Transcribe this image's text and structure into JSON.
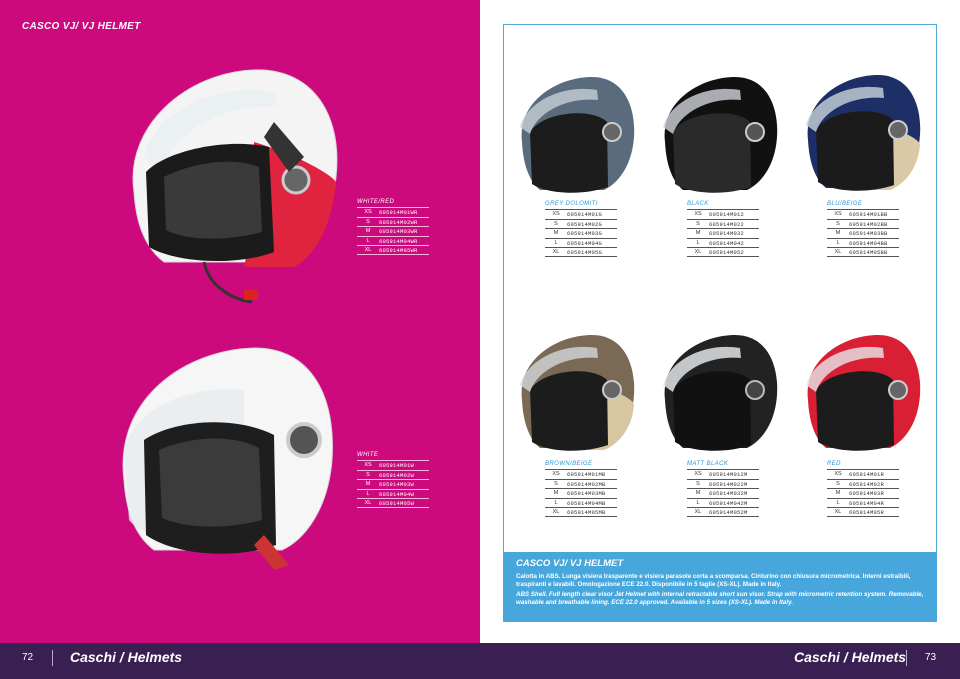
{
  "left_page": {
    "title": "CASCO VJ/ VJ HELMET",
    "page_number": "72",
    "section": "Caschi / Helmets",
    "products": [
      {
        "color_name": "WHITE/RED",
        "rows": [
          {
            "size": "XS",
            "code": "605914M01WR"
          },
          {
            "size": "S",
            "code": "605914M02WR"
          },
          {
            "size": "M",
            "code": "605914M03WR"
          },
          {
            "size": "L",
            "code": "605914M04WR"
          },
          {
            "size": "XL",
            "code": "605914M05WR"
          }
        ]
      },
      {
        "color_name": "WHITE",
        "rows": [
          {
            "size": "XS",
            "code": "605914M01W"
          },
          {
            "size": "S",
            "code": "605914M02W"
          },
          {
            "size": "M",
            "code": "605914M03W"
          },
          {
            "size": "L",
            "code": "605914M04W"
          },
          {
            "size": "XL",
            "code": "605914M05W"
          }
        ]
      }
    ]
  },
  "right_page": {
    "page_number": "73",
    "section": "Caschi / Helmets",
    "products": [
      {
        "color_name": "GREY DOLOMITI",
        "rows": [
          {
            "size": "XS",
            "code": "605914M01G"
          },
          {
            "size": "S",
            "code": "605914M02G"
          },
          {
            "size": "M",
            "code": "605914M03G"
          },
          {
            "size": "L",
            "code": "605914M04G"
          },
          {
            "size": "XL",
            "code": "605914M05G"
          }
        ]
      },
      {
        "color_name": "BLACK",
        "rows": [
          {
            "size": "XS",
            "code": "605914M012"
          },
          {
            "size": "S",
            "code": "605914M022"
          },
          {
            "size": "M",
            "code": "605914M032"
          },
          {
            "size": "L",
            "code": "605914M042"
          },
          {
            "size": "XL",
            "code": "605914M052"
          }
        ]
      },
      {
        "color_name": "BLU/BEIGE",
        "rows": [
          {
            "size": "XS",
            "code": "605914M01BB"
          },
          {
            "size": "S",
            "code": "605914M02BB"
          },
          {
            "size": "M",
            "code": "605914M03BB"
          },
          {
            "size": "L",
            "code": "605914M04BB"
          },
          {
            "size": "XL",
            "code": "605914M05BB"
          }
        ]
      },
      {
        "color_name": "BROWN/BEIGE",
        "rows": [
          {
            "size": "XS",
            "code": "605914M01MB"
          },
          {
            "size": "S",
            "code": "605914M02MB"
          },
          {
            "size": "M",
            "code": "605914M03MB"
          },
          {
            "size": "L",
            "code": "605914M04MB"
          },
          {
            "size": "XL",
            "code": "605914M05MB"
          }
        ]
      },
      {
        "color_name": "MATT BLACK",
        "rows": [
          {
            "size": "XS",
            "code": "605914M012M"
          },
          {
            "size": "S",
            "code": "605914M022M"
          },
          {
            "size": "M",
            "code": "605914M032M"
          },
          {
            "size": "L",
            "code": "605914M042M"
          },
          {
            "size": "XL",
            "code": "605914M052M"
          }
        ]
      },
      {
        "color_name": "RED",
        "rows": [
          {
            "size": "XS",
            "code": "605914M01R"
          },
          {
            "size": "S",
            "code": "605914M02R"
          },
          {
            "size": "M",
            "code": "605914M03R"
          },
          {
            "size": "L",
            "code": "605914M04R"
          },
          {
            "size": "XL",
            "code": "605914M05R"
          }
        ]
      }
    ],
    "info": {
      "title": "CASCO VJ/ VJ HELMET",
      "text_it": "Calotta in ABS. Lunga visiera trasparente e visiera parasole corta a scomparsa. Cinturino con chiusura micrometrica. Interni estraibili, traspiranti e lavabili. Omologazione ECE 22.0. Disponibile in 5 taglie (XS-XL). Made in Italy.",
      "text_en": "ABS Shell. Full length clear visor Jet Helmet with internal retractable short sun visor. Strap with micrometric retention system. Removable, washable and breathable lining. ECE 22.0 approved. Available in 5 sizes (XS-XL). Made in Italy."
    }
  },
  "colors": {
    "magenta": "#cc0a7d",
    "footer": "#3a1f52",
    "accent_blue": "#47a7dc"
  }
}
